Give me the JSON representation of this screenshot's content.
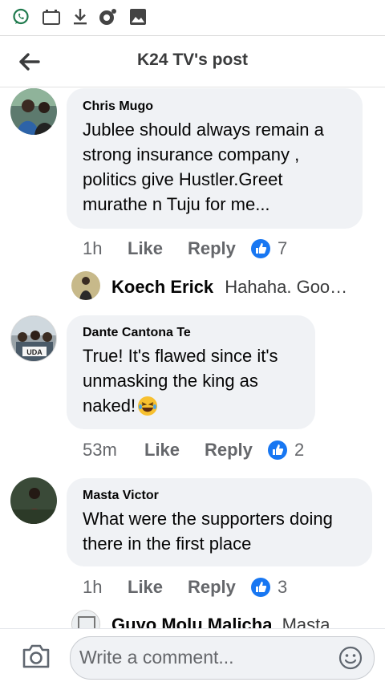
{
  "header": {
    "title": "K24 TV's post"
  },
  "comments": [
    {
      "author": "Chris Mugo",
      "lines": [
        "Jublee should always remain a",
        "strong insurance company ,",
        "politics give Hustler.Greet",
        "murathe n Tuju for me..."
      ],
      "time": "1h",
      "like_label": "Like",
      "reply_label": "Reply",
      "reactions": "7",
      "reply_preview": {
        "author": "Koech Erick",
        "text": "Hahaha. Goo…"
      }
    },
    {
      "author": "Dante Cantona Te",
      "lines": [
        "True! It's flawed since it's",
        "unmasking the king as",
        "naked!"
      ],
      "avatar_text": "UDA",
      "time": "53m",
      "like_label": "Like",
      "reply_label": "Reply",
      "reactions": "2"
    },
    {
      "author": "Masta Victor",
      "lines": [
        "What were the supporters doing",
        "there in the first place"
      ],
      "time": "1h",
      "like_label": "Like",
      "reply_label": "Reply",
      "reactions": "3",
      "reply_preview": {
        "author": "Guyo Molu Malicha",
        "text": "Masta"
      }
    }
  ],
  "composer": {
    "placeholder": "Write a comment..."
  },
  "colors": {
    "accent": "#1877f2",
    "bubble": "#f0f2f5",
    "meta": "#65676b"
  },
  "icons": [
    "whatsapp-icon",
    "calendar-icon",
    "download-icon",
    "eye-icon",
    "image-icon",
    "back-arrow-icon",
    "like-reaction-icon",
    "camera-icon",
    "emoji-icon",
    "laughing-emoji-icon"
  ]
}
